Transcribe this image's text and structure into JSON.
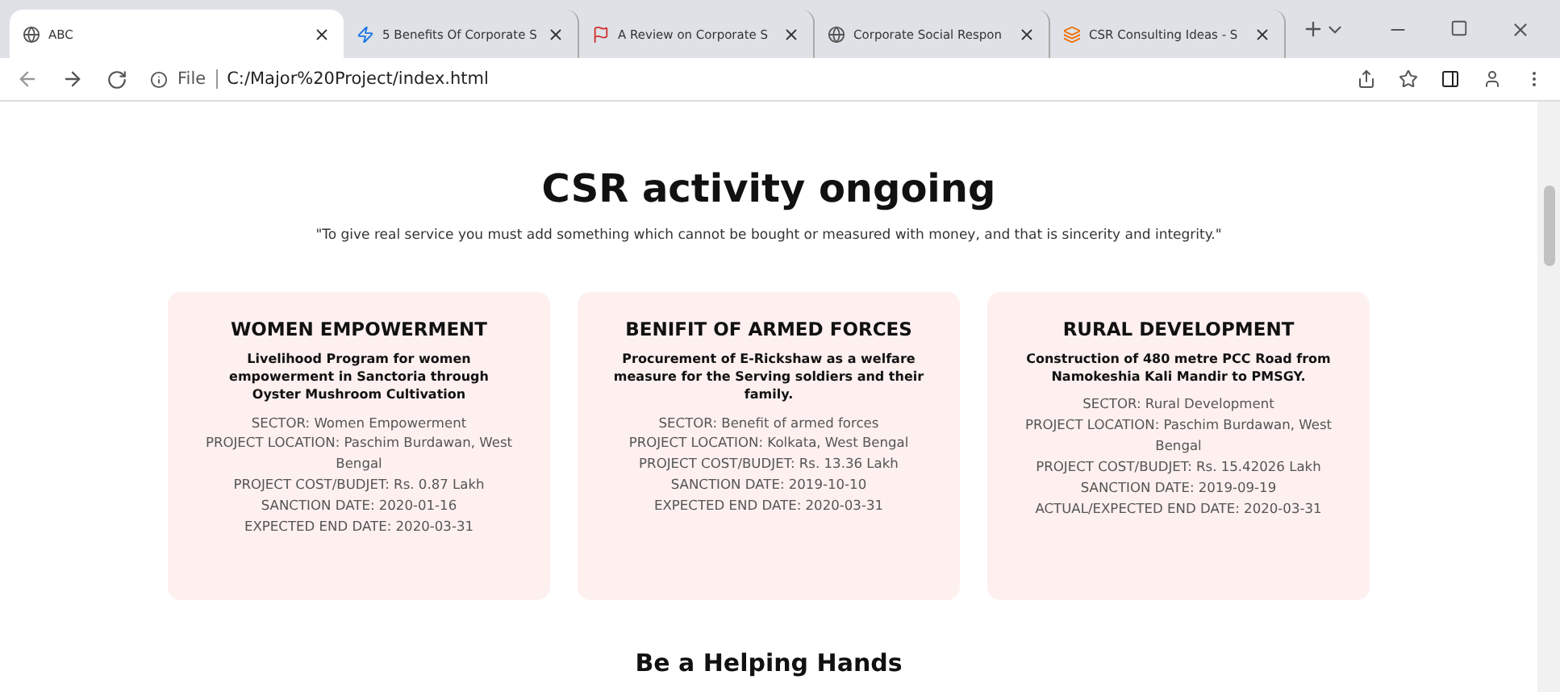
{
  "browser": {
    "tabs": [
      {
        "title": "ABC",
        "selected": true
      },
      {
        "title": "5 Benefits Of Corporate S",
        "selected": false
      },
      {
        "title": "A Review on Corporate S",
        "selected": false
      },
      {
        "title": "Corporate Social Respon",
        "selected": false
      },
      {
        "title": "CSR Consulting Ideas - S",
        "selected": false
      }
    ],
    "address": {
      "scheme": "File",
      "url": "C:/Major%20Project/index.html"
    }
  },
  "page": {
    "title": "CSR activity ongoing",
    "quote": "\"To give real service you must add something which cannot be bought or measured with money, and that is sincerity and integrity.\"",
    "cards": [
      {
        "heading": "WOMEN EMPOWERMENT",
        "subtitle": "Livelihood Program for women empowerment in Sanctoria through Oyster Mushroom Cultivation",
        "details": [
          "SECTOR: Women Empowerment",
          "PROJECT LOCATION: Paschim Burdawan, West Bengal",
          "PROJECT COST/BUDJET: Rs. 0.87 Lakh",
          "SANCTION DATE: 2020-01-16",
          "EXPECTED END DATE: 2020-03-31"
        ]
      },
      {
        "heading": "BENIFIT OF ARMED FORCES",
        "subtitle": "Procurement of E-Rickshaw as a welfare measure for the Serving soldiers and their family.",
        "details": [
          "SECTOR: Benefit of armed forces",
          "PROJECT LOCATION: Kolkata, West Bengal",
          "PROJECT COST/BUDJET: Rs. 13.36 Lakh",
          "SANCTION DATE: 2019-10-10",
          "EXPECTED END DATE: 2020-03-31"
        ]
      },
      {
        "heading": "RURAL DEVELOPMENT",
        "subtitle": "Construction of 480 metre PCC Road from Namokeshia Kali Mandir to PMSGY.",
        "details": [
          "SECTOR: Rural Development",
          "PROJECT LOCATION: Paschim Burdawan, West Bengal",
          "PROJECT COST/BUDJET: Rs. 15.42026 Lakh",
          "SANCTION DATE: 2019-09-19",
          "ACTUAL/EXPECTED END DATE: 2020-03-31"
        ]
      }
    ],
    "next_heading": "Be a Helping Hands"
  }
}
